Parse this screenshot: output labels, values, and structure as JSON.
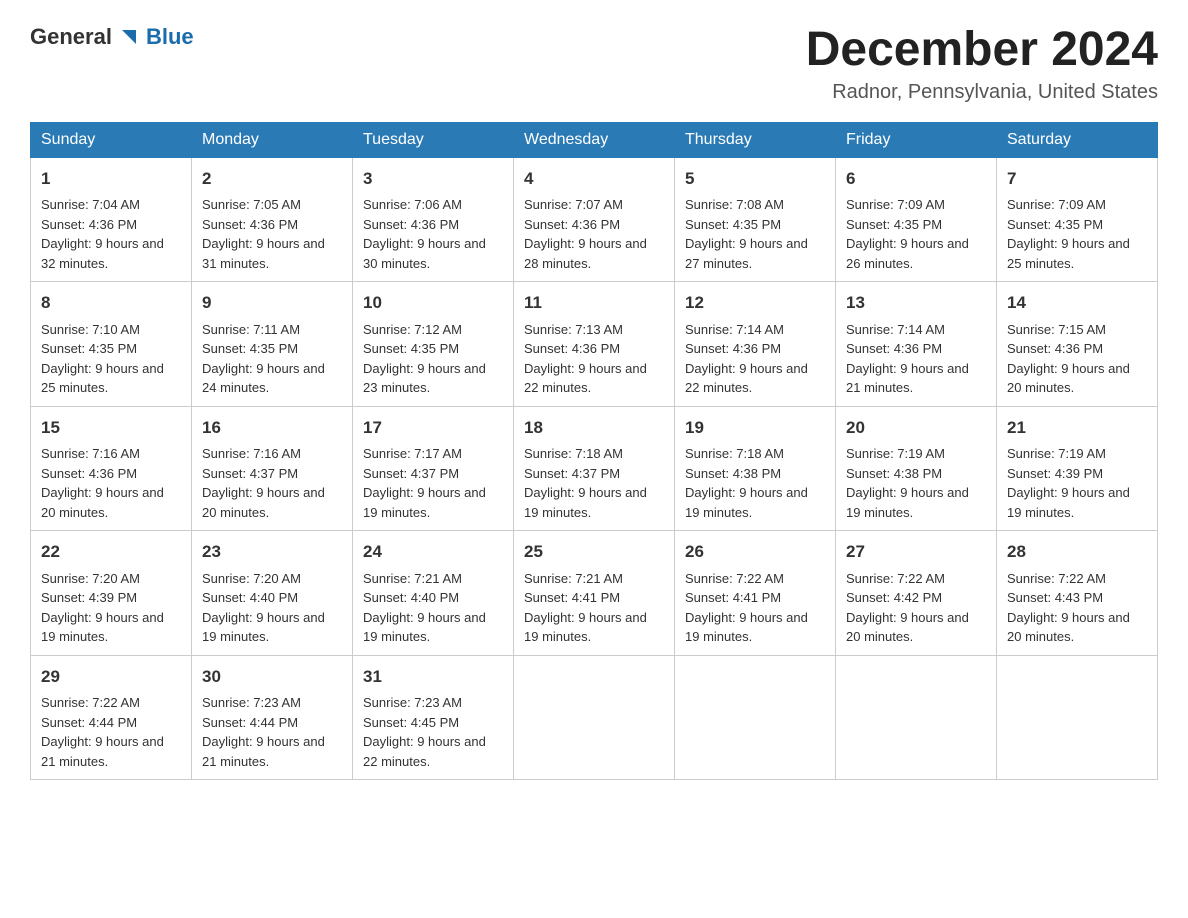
{
  "header": {
    "logo_general": "General",
    "logo_blue": "Blue",
    "title": "December 2024",
    "subtitle": "Radnor, Pennsylvania, United States"
  },
  "days_of_week": [
    "Sunday",
    "Monday",
    "Tuesday",
    "Wednesday",
    "Thursday",
    "Friday",
    "Saturday"
  ],
  "weeks": [
    [
      {
        "day": "1",
        "sunrise": "7:04 AM",
        "sunset": "4:36 PM",
        "daylight": "9 hours and 32 minutes."
      },
      {
        "day": "2",
        "sunrise": "7:05 AM",
        "sunset": "4:36 PM",
        "daylight": "9 hours and 31 minutes."
      },
      {
        "day": "3",
        "sunrise": "7:06 AM",
        "sunset": "4:36 PM",
        "daylight": "9 hours and 30 minutes."
      },
      {
        "day": "4",
        "sunrise": "7:07 AM",
        "sunset": "4:36 PM",
        "daylight": "9 hours and 28 minutes."
      },
      {
        "day": "5",
        "sunrise": "7:08 AM",
        "sunset": "4:35 PM",
        "daylight": "9 hours and 27 minutes."
      },
      {
        "day": "6",
        "sunrise": "7:09 AM",
        "sunset": "4:35 PM",
        "daylight": "9 hours and 26 minutes."
      },
      {
        "day": "7",
        "sunrise": "7:09 AM",
        "sunset": "4:35 PM",
        "daylight": "9 hours and 25 minutes."
      }
    ],
    [
      {
        "day": "8",
        "sunrise": "7:10 AM",
        "sunset": "4:35 PM",
        "daylight": "9 hours and 25 minutes."
      },
      {
        "day": "9",
        "sunrise": "7:11 AM",
        "sunset": "4:35 PM",
        "daylight": "9 hours and 24 minutes."
      },
      {
        "day": "10",
        "sunrise": "7:12 AM",
        "sunset": "4:35 PM",
        "daylight": "9 hours and 23 minutes."
      },
      {
        "day": "11",
        "sunrise": "7:13 AM",
        "sunset": "4:36 PM",
        "daylight": "9 hours and 22 minutes."
      },
      {
        "day": "12",
        "sunrise": "7:14 AM",
        "sunset": "4:36 PM",
        "daylight": "9 hours and 22 minutes."
      },
      {
        "day": "13",
        "sunrise": "7:14 AM",
        "sunset": "4:36 PM",
        "daylight": "9 hours and 21 minutes."
      },
      {
        "day": "14",
        "sunrise": "7:15 AM",
        "sunset": "4:36 PM",
        "daylight": "9 hours and 20 minutes."
      }
    ],
    [
      {
        "day": "15",
        "sunrise": "7:16 AM",
        "sunset": "4:36 PM",
        "daylight": "9 hours and 20 minutes."
      },
      {
        "day": "16",
        "sunrise": "7:16 AM",
        "sunset": "4:37 PM",
        "daylight": "9 hours and 20 minutes."
      },
      {
        "day": "17",
        "sunrise": "7:17 AM",
        "sunset": "4:37 PM",
        "daylight": "9 hours and 19 minutes."
      },
      {
        "day": "18",
        "sunrise": "7:18 AM",
        "sunset": "4:37 PM",
        "daylight": "9 hours and 19 minutes."
      },
      {
        "day": "19",
        "sunrise": "7:18 AM",
        "sunset": "4:38 PM",
        "daylight": "9 hours and 19 minutes."
      },
      {
        "day": "20",
        "sunrise": "7:19 AM",
        "sunset": "4:38 PM",
        "daylight": "9 hours and 19 minutes."
      },
      {
        "day": "21",
        "sunrise": "7:19 AM",
        "sunset": "4:39 PM",
        "daylight": "9 hours and 19 minutes."
      }
    ],
    [
      {
        "day": "22",
        "sunrise": "7:20 AM",
        "sunset": "4:39 PM",
        "daylight": "9 hours and 19 minutes."
      },
      {
        "day": "23",
        "sunrise": "7:20 AM",
        "sunset": "4:40 PM",
        "daylight": "9 hours and 19 minutes."
      },
      {
        "day": "24",
        "sunrise": "7:21 AM",
        "sunset": "4:40 PM",
        "daylight": "9 hours and 19 minutes."
      },
      {
        "day": "25",
        "sunrise": "7:21 AM",
        "sunset": "4:41 PM",
        "daylight": "9 hours and 19 minutes."
      },
      {
        "day": "26",
        "sunrise": "7:22 AM",
        "sunset": "4:41 PM",
        "daylight": "9 hours and 19 minutes."
      },
      {
        "day": "27",
        "sunrise": "7:22 AM",
        "sunset": "4:42 PM",
        "daylight": "9 hours and 20 minutes."
      },
      {
        "day": "28",
        "sunrise": "7:22 AM",
        "sunset": "4:43 PM",
        "daylight": "9 hours and 20 minutes."
      }
    ],
    [
      {
        "day": "29",
        "sunrise": "7:22 AM",
        "sunset": "4:44 PM",
        "daylight": "9 hours and 21 minutes."
      },
      {
        "day": "30",
        "sunrise": "7:23 AM",
        "sunset": "4:44 PM",
        "daylight": "9 hours and 21 minutes."
      },
      {
        "day": "31",
        "sunrise": "7:23 AM",
        "sunset": "4:45 PM",
        "daylight": "9 hours and 22 minutes."
      },
      null,
      null,
      null,
      null
    ]
  ]
}
